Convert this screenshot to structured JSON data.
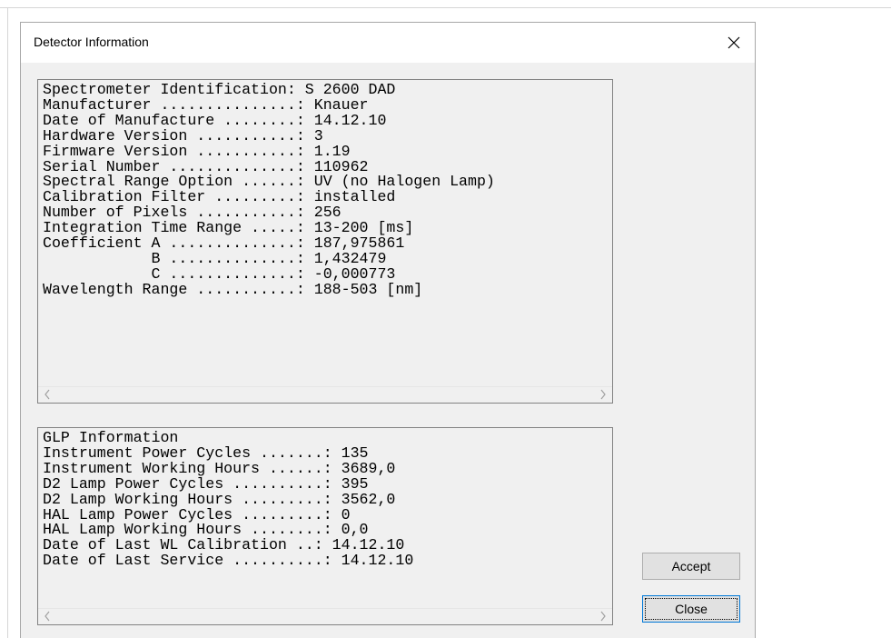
{
  "window": {
    "title": "Detector Information",
    "close_icon": "close-icon"
  },
  "detector_panel": {
    "lines": [
      "Spectrometer Identification: S 2600 DAD",
      "Manufacturer ...............: Knauer",
      "Date of Manufacture ........: 14.12.10",
      "Hardware Version ...........: 3",
      "Firmware Version ...........: 1.19",
      "Serial Number ..............: 110962",
      "Spectral Range Option ......: UV (no Halogen Lamp)",
      "Calibration Filter .........: installed",
      "Number of Pixels ...........: 256",
      "Integration Time Range .....: 13-200 [ms]",
      "Coefficient A ..............: 187,975861",
      "            B ..............: 1,432479",
      "            C ..............: -0,000773",
      "Wavelength Range ...........: 188-503 [nm]"
    ]
  },
  "glp_panel": {
    "lines": [
      "GLP Information",
      "Instrument Power Cycles .......: 135",
      "Instrument Working Hours ......: 3689,0",
      "D2 Lamp Power Cycles ..........: 395",
      "D2 Lamp Working Hours .........: 3562,0",
      "HAL Lamp Power Cycles .........: 0",
      "HAL Lamp Working Hours ........: 0,0",
      "Date of Last WL Calibration ..: 14.12.10",
      "Date of Last Service ..........: 14.12.10"
    ]
  },
  "buttons": {
    "accept_label": "Accept",
    "close_label": "Close"
  }
}
